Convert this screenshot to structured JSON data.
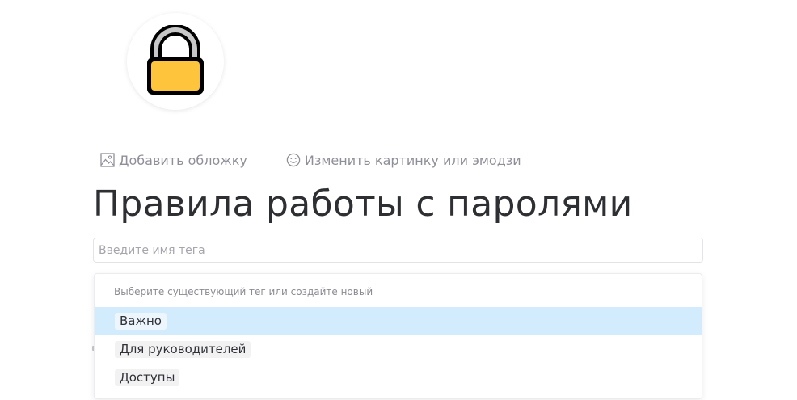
{
  "page": {
    "icon": "lock-icon",
    "title": "Правила работы с паролями"
  },
  "actions": {
    "add_cover": {
      "label": "Добавить обложку",
      "icon": "image-icon"
    },
    "change_icon": {
      "label": "Изменить картинку или эмодзи",
      "icon": "smiley-icon"
    }
  },
  "tag_input": {
    "value": "",
    "placeholder": "Введите имя тега"
  },
  "tag_dropdown": {
    "hint": "Выберите существующий тег или создайте новый",
    "options": [
      {
        "label": "Важно",
        "selected": true
      },
      {
        "label": "Для руководителей",
        "selected": false
      },
      {
        "label": "Доступы",
        "selected": false
      }
    ]
  },
  "colors": {
    "lock_body": "#FEC43B",
    "lock_shackle": "#C8C8C8",
    "lock_outline": "#000000",
    "selected_row": "#D2EBFD",
    "muted_text": "#8F8F9A"
  }
}
